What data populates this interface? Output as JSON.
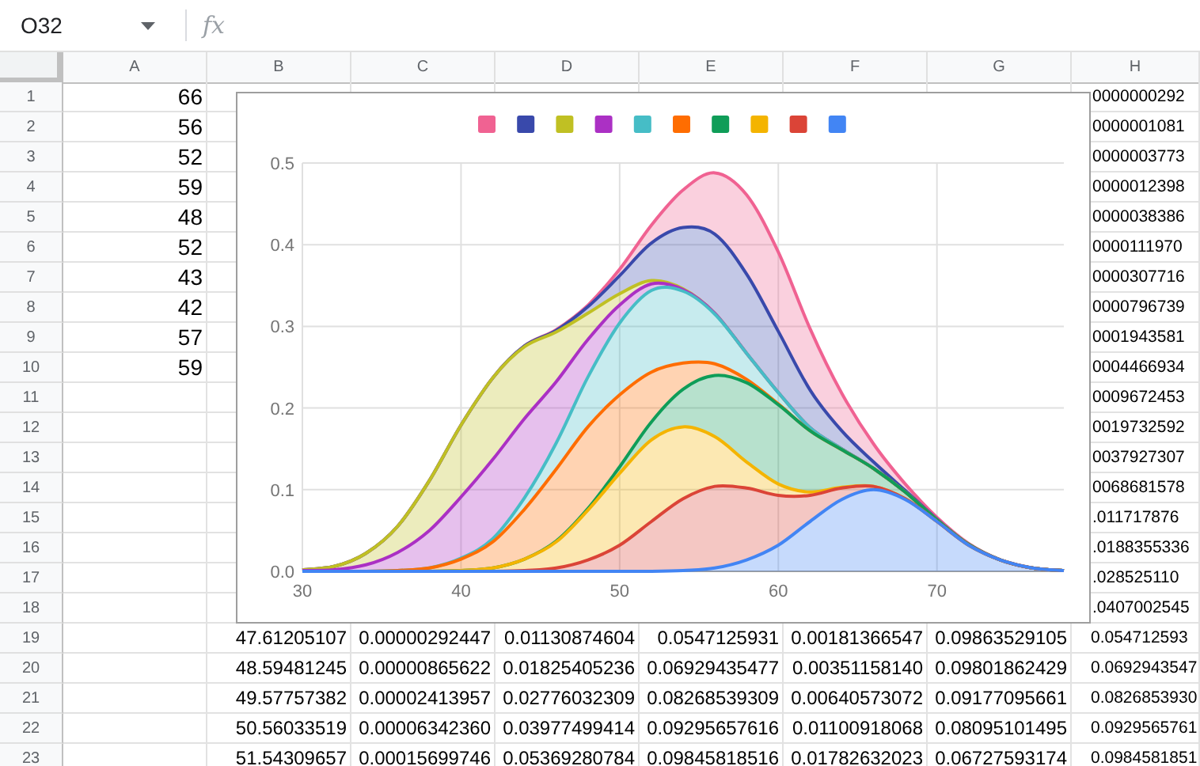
{
  "name_box": {
    "value": "O32"
  },
  "formula_bar": {
    "icon_text": "fx"
  },
  "columns": [
    "A",
    "B",
    "C",
    "D",
    "E",
    "F",
    "G",
    "H"
  ],
  "rows": [
    {
      "number": "1",
      "cells": {
        "a": "66",
        "h": "0000000292"
      }
    },
    {
      "number": "2",
      "cells": {
        "a": "56",
        "h": "0000001081"
      }
    },
    {
      "number": "3",
      "cells": {
        "a": "52",
        "h": "0000003773"
      }
    },
    {
      "number": "4",
      "cells": {
        "a": "59",
        "h": "0000012398"
      }
    },
    {
      "number": "5",
      "cells": {
        "a": "48",
        "h": "0000038386"
      }
    },
    {
      "number": "6",
      "cells": {
        "a": "52",
        "h": "0000111970"
      }
    },
    {
      "number": "7",
      "cells": {
        "a": "43",
        "h": "0000307716"
      }
    },
    {
      "number": "8",
      "cells": {
        "a": "42",
        "h": "0000796739"
      }
    },
    {
      "number": "9",
      "cells": {
        "a": "57",
        "h": "0001943581"
      }
    },
    {
      "number": "10",
      "cells": {
        "a": "59",
        "h": "0004466934"
      }
    },
    {
      "number": "11",
      "cells": {
        "h": "0009672453"
      }
    },
    {
      "number": "12",
      "cells": {
        "h": "0019732592"
      }
    },
    {
      "number": "13",
      "cells": {
        "h": "0037927307"
      }
    },
    {
      "number": "14",
      "cells": {
        "h": "0068681578"
      }
    },
    {
      "number": "15",
      "cells": {
        "h": ".011717876"
      }
    },
    {
      "number": "16",
      "cells": {
        "h": ".0188355336"
      }
    },
    {
      "number": "17",
      "cells": {
        "h": ".028525110"
      }
    },
    {
      "number": "18",
      "cells": {
        "h": ".0407002545"
      }
    },
    {
      "number": "19",
      "cells": {
        "b": "47.61205107",
        "c": "0.00000292447",
        "d": "0.01130874604",
        "e": "0.0547125931",
        "f": "0.00181366547",
        "g": "0.09863529105",
        "h": "0.054712593"
      }
    },
    {
      "number": "20",
      "cells": {
        "b": "48.59481245",
        "c": "0.00000865622",
        "d": "0.01825405236",
        "e": "0.06929435477",
        "f": "0.00351158140",
        "g": "0.09801862429",
        "h": "0.0692943547"
      }
    },
    {
      "number": "21",
      "cells": {
        "b": "49.57757382",
        "c": "0.00002413957",
        "d": "0.02776032309",
        "e": "0.08268539309",
        "f": "0.00640573072",
        "g": "0.09177095661",
        "h": "0.0826853930"
      }
    },
    {
      "number": "22",
      "cells": {
        "b": "50.56033519",
        "c": "0.00006342360",
        "d": "0.03977499414",
        "e": "0.09295657616",
        "f": "0.01100918068",
        "g": "0.08095101495",
        "h": "0.0929565761"
      }
    },
    {
      "number": "23",
      "cells": {
        "b": "51.54309657",
        "c": "0.00015699746",
        "d": "0.05369280784",
        "e": "0.09845818516",
        "f": "0.01782632023",
        "g": "0.06727593174",
        "h": "0.0984581851"
      }
    }
  ],
  "chart": {
    "chart_data": {
      "type": "area",
      "stacked": true,
      "grid": true,
      "x": [
        30,
        32,
        34,
        36,
        38,
        40,
        42,
        44,
        46,
        48,
        50,
        52,
        54,
        56,
        58,
        60,
        62,
        64,
        66,
        68,
        70,
        72,
        74,
        76,
        78
      ],
      "xlim": [
        30,
        78
      ],
      "ylim": [
        0,
        0.5
      ],
      "xticks": [
        30,
        40,
        50,
        60,
        70
      ],
      "yticks": [
        {
          "value": 0,
          "label": "0.0"
        },
        0.1,
        0.2,
        0.3,
        0.4,
        0.5
      ],
      "series": [
        {
          "color": "#f06292",
          "values": [
            0,
            0,
            0,
            0,
            0,
            0,
            0,
            0,
            0.001,
            0.002,
            0.008,
            0.022,
            0.046,
            0.075,
            0.097,
            0.097,
            0.075,
            0.046,
            0.022,
            0.008,
            0.002,
            0.001,
            0,
            0,
            0
          ]
        },
        {
          "color": "#3949ab",
          "values": [
            0,
            0,
            0,
            0,
            0,
            0,
            0,
            0.001,
            0.002,
            0.008,
            0.022,
            0.046,
            0.075,
            0.097,
            0.097,
            0.075,
            0.046,
            0.022,
            0.008,
            0.002,
            0.001,
            0,
            0,
            0,
            0
          ]
        },
        {
          "color": "#c0c023",
          "values": [
            0.001,
            0.004,
            0.014,
            0.032,
            0.061,
            0.088,
            0.1,
            0.088,
            0.061,
            0.032,
            0.014,
            0.004,
            0.001,
            0,
            0,
            0,
            0,
            0,
            0,
            0,
            0,
            0,
            0,
            0,
            0
          ]
        },
        {
          "color": "#ab30c4",
          "values": [
            0.001,
            0.002,
            0.008,
            0.022,
            0.046,
            0.075,
            0.097,
            0.097,
            0.075,
            0.046,
            0.022,
            0.008,
            0.002,
            0.001,
            0,
            0,
            0,
            0,
            0,
            0,
            0,
            0,
            0,
            0,
            0
          ]
        },
        {
          "color": "#46bdc6",
          "values": [
            0,
            0,
            0,
            0,
            0,
            0.001,
            0.004,
            0.014,
            0.032,
            0.061,
            0.088,
            0.1,
            0.088,
            0.061,
            0.032,
            0.014,
            0.004,
            0.001,
            0,
            0,
            0,
            0,
            0,
            0,
            0
          ]
        },
        {
          "color": "#ff6d01",
          "values": [
            0,
            0,
            0,
            0.001,
            0.004,
            0.014,
            0.032,
            0.061,
            0.088,
            0.1,
            0.088,
            0.061,
            0.032,
            0.014,
            0.004,
            0.001,
            0,
            0,
            0,
            0,
            0,
            0,
            0,
            0,
            0
          ]
        },
        {
          "color": "#0f9d58",
          "values": [
            0,
            0,
            0,
            0,
            0,
            0,
            0,
            0,
            0.001,
            0.002,
            0.008,
            0.022,
            0.046,
            0.075,
            0.097,
            0.097,
            0.075,
            0.046,
            0.022,
            0.008,
            0.002,
            0.001,
            0,
            0,
            0
          ]
        },
        {
          "color": "#f4b400",
          "values": [
            0,
            0,
            0,
            0,
            0,
            0.001,
            0.004,
            0.014,
            0.032,
            0.061,
            0.088,
            0.1,
            0.088,
            0.061,
            0.032,
            0.014,
            0.004,
            0.001,
            0,
            0,
            0,
            0,
            0,
            0,
            0
          ]
        },
        {
          "color": "#db4437",
          "values": [
            0,
            0,
            0,
            0,
            0,
            0,
            0,
            0.001,
            0.004,
            0.014,
            0.032,
            0.061,
            0.088,
            0.1,
            0.088,
            0.061,
            0.032,
            0.014,
            0.004,
            0.001,
            0,
            0,
            0,
            0,
            0
          ]
        },
        {
          "color": "#4285f4",
          "values": [
            0,
            0,
            0,
            0,
            0,
            0,
            0,
            0,
            0,
            0,
            0,
            0,
            0.001,
            0.004,
            0.014,
            0.032,
            0.061,
            0.088,
            0.1,
            0.088,
            0.061,
            0.032,
            0.014,
            0.004,
            0.001
          ]
        }
      ]
    }
  }
}
